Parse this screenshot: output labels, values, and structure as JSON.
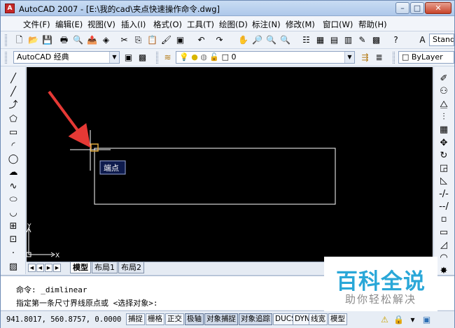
{
  "window": {
    "title": "AutoCAD 2007 - [E:\\我的cad\\夹点快速操作命令.dwg]",
    "min_label": "–",
    "max_label": "□",
    "close_label": "✕"
  },
  "menu": {
    "doc_icon": "A",
    "items": [
      "文件(F)",
      "编辑(E)",
      "视图(V)",
      "插入(I)",
      "格式(O)",
      "工具(T)",
      "绘图(D)",
      "标注(N)",
      "修改(M)",
      "窗口(W)",
      "帮助(H)"
    ],
    "mdi_min": "–",
    "mdi_restore": "❐",
    "mdi_close": "✕"
  },
  "toolbar1": {
    "style_combo": "Stand"
  },
  "toolbar2": {
    "workspace": "AutoCAD 经典",
    "layer": "0",
    "color": "ByLayer"
  },
  "icons": {
    "tb1": [
      "new-icon",
      "open-icon",
      "save-icon",
      "print-icon",
      "print-preview-icon",
      "publish-icon",
      "3d-dwf-icon",
      "cut-icon",
      "copy-icon",
      "paste-icon",
      "match-properties-icon",
      "block-editor-icon",
      "undo-icon",
      "redo-icon",
      "pan-icon",
      "zoom-realtime-icon",
      "zoom-window-icon",
      "zoom-previous-icon",
      "properties-icon",
      "design-center-icon",
      "tool-palettes-icon",
      "sheet-set-icon",
      "markup-icon",
      "calculator-icon",
      "help-icon",
      "text-style-icon"
    ],
    "tb1_glyphs": [
      "🗋",
      "📂",
      "💾",
      "🖶",
      "🔍",
      "📤",
      "◈",
      "✂",
      "⎘",
      "📋",
      "🖌",
      "▣",
      "↶",
      "↷",
      "✋",
      "🔎",
      "🔍",
      "🔍",
      "☷",
      "▦",
      "▤",
      "▥",
      "✎",
      "▩",
      "?",
      "A"
    ],
    "left": [
      "line-icon",
      "construction-line-icon",
      "polyline-icon",
      "polygon-icon",
      "rectangle-icon",
      "arc-icon",
      "circle-icon",
      "revision-cloud-icon",
      "spline-icon",
      "ellipse-icon",
      "ellipse-arc-icon",
      "insert-block-icon",
      "make-block-icon",
      "point-icon",
      "hatch-icon"
    ],
    "left_glyphs": [
      "╱",
      "╱",
      "⤴",
      "⬠",
      "▭",
      "◜",
      "◯",
      "☁",
      "∿",
      "⬭",
      "◡",
      "⊞",
      "⊡",
      "·",
      "▨"
    ],
    "right": [
      "erase-icon",
      "copy-object-icon",
      "mirror-icon",
      "offset-icon",
      "array-icon",
      "move-icon",
      "rotate-icon",
      "scale-icon",
      "stretch-icon",
      "trim-icon",
      "extend-icon",
      "break-icon",
      "join-icon",
      "chamfer-icon",
      "fillet-icon",
      "explode-icon"
    ],
    "right_glyphs": [
      "✐",
      "⚇",
      "⧋",
      "⫶",
      "▦",
      "✥",
      "↻",
      "◲",
      "◺",
      "-/-",
      "--/",
      "▫",
      "▭",
      "◿",
      "◠",
      "✸"
    ]
  },
  "canvas": {
    "tooltip": "端点",
    "ucs_x": "X",
    "ucs_y": "Y",
    "arrow_color": "#e53935",
    "rect_color": "#ffffff"
  },
  "layout_tabs": [
    "模型",
    "布局1",
    "布局2"
  ],
  "command": {
    "line1": "命令: _dimlinear",
    "line2": "指定第一条尺寸界线原点或 <选择对象>:"
  },
  "status": {
    "coords": "941.8017,  560.8757, 0.0000",
    "buttons": [
      "捕捉",
      "栅格",
      "正交",
      "极轴",
      "对象捕捉",
      "对象追踪",
      "DUCS",
      "DYN",
      "线宽",
      "模型"
    ]
  },
  "watermark": {
    "title": "百科全说",
    "subtitle": "助你轻松解决"
  }
}
